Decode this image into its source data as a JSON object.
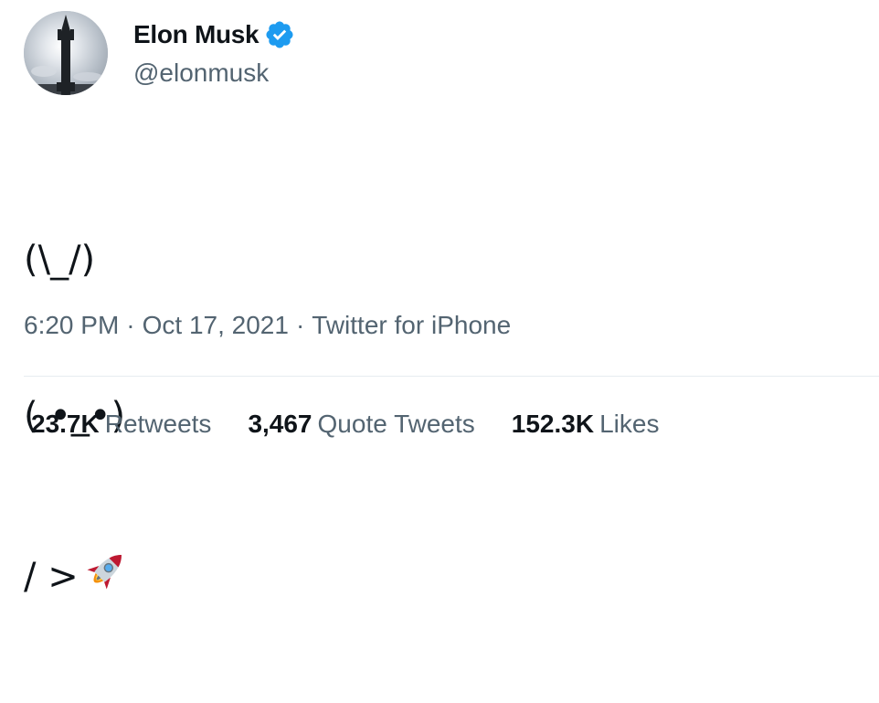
{
  "author": {
    "display_name": "Elon Musk",
    "handle": "@elonmusk",
    "verified": true
  },
  "tweet": {
    "lines": [
      "(\\_/)",
      "( •_•)",
      "/ >"
    ],
    "emoji": "rocket",
    "time": "6:20 PM",
    "date": "Oct 17, 2021",
    "separator": "·",
    "source": "Twitter for iPhone"
  },
  "stats": {
    "retweets": {
      "count": "23.7K",
      "label": "Retweets"
    },
    "quote_tweets": {
      "count": "3,467",
      "label": "Quote Tweets"
    },
    "likes": {
      "count": "152.3K",
      "label": "Likes"
    }
  },
  "colors": {
    "text": "#0f1419",
    "secondary": "#536471",
    "verified_blue": "#1d9bf0",
    "divider": "#e6ecf0"
  },
  "icons": {
    "verified": "verified-badge-icon",
    "emoji": "rocket-icon"
  }
}
